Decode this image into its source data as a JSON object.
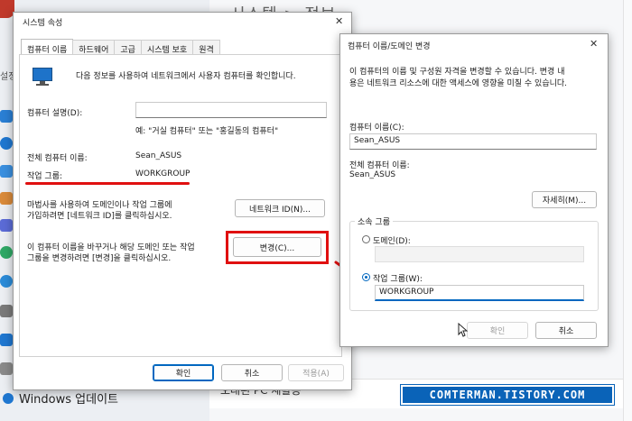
{
  "background": {
    "title": "시스템 > 정보",
    "side_label": "설정",
    "windows_update": "Windows 업데이트",
    "card_text": "오래된 PC 재활용"
  },
  "system_props": {
    "title": "시스템 속성",
    "close": "✕",
    "tabs": [
      "컴퓨터 이름",
      "하드웨어",
      "고급",
      "시스템 보호",
      "원격"
    ],
    "intro": "다음 정보를 사용하여 네트워크에서 사용자 컴퓨터를 확인합니다.",
    "description_label": "컴퓨터 설명(D):",
    "description_value": "",
    "example": "예: \"거실 컴퓨터\" 또는 \"홍길동의 컴퓨터\"",
    "fullname_label": "전체 컴퓨터 이름:",
    "fullname_value": "Sean_ASUS",
    "workgroup_label": "작업 그룹:",
    "workgroup_value": "WORKGROUP",
    "wizard_text_1": "마법사를 사용하여 도메인이나 작업 그룹에",
    "wizard_text_2": "가입하려면 [네트워크 ID]를 클릭하십시오.",
    "network_id_button": "네트워크 ID(N)...",
    "rename_text_1": "이 컴퓨터 이름을 바꾸거나 해당 도메인 또는 작업",
    "rename_text_2": "그룹을 변경하려면 [변경]을 클릭하십시오.",
    "change_button": "변경(C)...",
    "ok_button": "확인",
    "cancel_button": "취소",
    "apply_button": "적용(A)"
  },
  "rename_dialog": {
    "title": "컴퓨터 이름/도메인 변경",
    "close": "✕",
    "intro_1": "이 컴퓨터의 이름 및 구성원 자격을 변경할 수 있습니다. 변경 내",
    "intro_2": "용은 네트워크 리소스에 대한 액세스에 영향을 미칠 수 있습니다.",
    "computer_name_label": "컴퓨터 이름(C):",
    "computer_name_value": "Sean_ASUS",
    "fullname_label": "전체 컴퓨터 이름:",
    "fullname_value": "Sean_ASUS",
    "more_button": "자세히(M)...",
    "member_of_label": "소속 그룹",
    "domain_label": "도메인(D):",
    "domain_value": "",
    "workgroup_label": "작업 그룹(W):",
    "workgroup_value": "WORKGROUP",
    "ok_button": "확인",
    "cancel_button": "취소"
  },
  "watermark": "COMTERMAN.TISTORY.COM",
  "colors": {
    "highlight": "#e01010",
    "accent": "#0067c0",
    "watermark_bg": "#0a63b8"
  }
}
